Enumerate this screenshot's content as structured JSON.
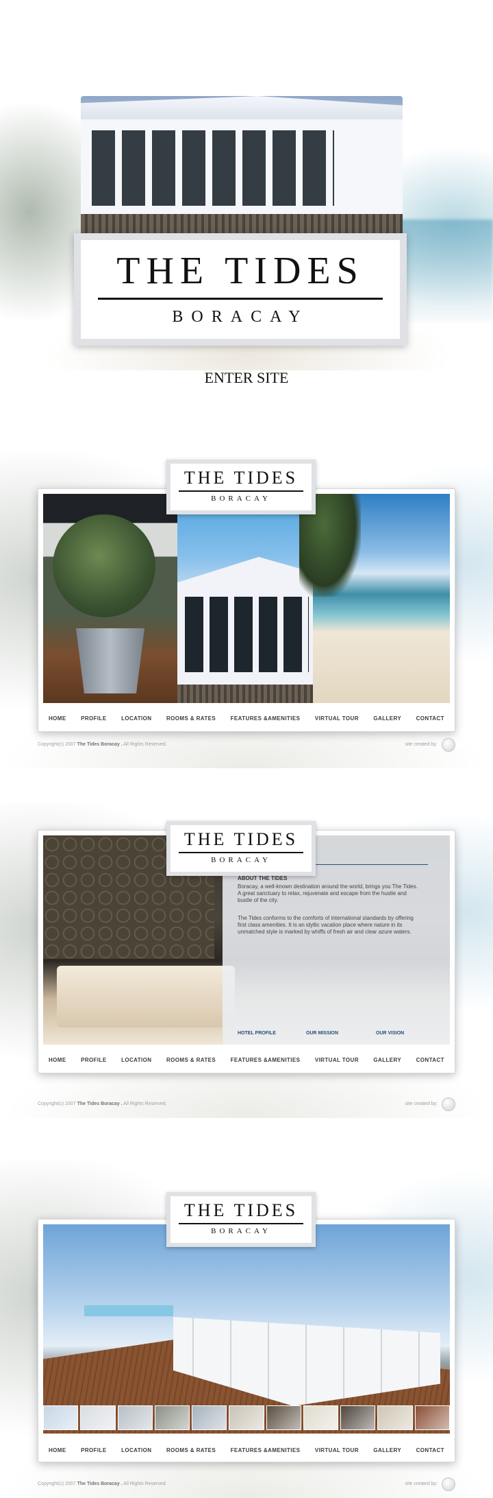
{
  "splash": {
    "brand_title": "THE TIDES",
    "brand_subtitle": "BORACAY",
    "enter_label": "ENTER SITE"
  },
  "brand": {
    "title": "THE TIDES",
    "subtitle": "BORACAY"
  },
  "nav": {
    "items": [
      "HOME",
      "PROFILE",
      "LOCATION",
      "ROOMS & RATES",
      "FEATURES &AMENITIES",
      "VIRTUAL TOUR",
      "GALLERY",
      "CONTACT"
    ]
  },
  "footer": {
    "copyright_prefix": "Copyright(c) 2007",
    "copyright_brand": "The Tides Boracay .",
    "copyright_suffix": "All Rights Reserved.",
    "credit": "site created by:"
  },
  "profile": {
    "title": "profile",
    "heading": "ABOUT THE TIDES",
    "paragraph1": "Boracay, a well-known destination around the world, brings you The Tides. A great sanctuary to relax, rejuvenate and escape from the hustle and bustle of the city.",
    "paragraph2": "The Tides conforms to the comforts of international standards by offering first class amenities. It is an idyllic vacation place where nature in its unmatched style is marked by whiffs of fresh air and clear azure waters.",
    "links": [
      "HOTEL PROFILE",
      "OUR  MISSION",
      "OUR VISION"
    ]
  },
  "gallery": {
    "thumbnail_colors": [
      "#c7d6e6",
      "#d9dde2",
      "#b7bfc7",
      "#8c8f86",
      "#a7b2bd",
      "#c9c3b5",
      "#5a4e40",
      "#e0dbcf",
      "#4f463d",
      "#cfc6b4",
      "#8a4f35"
    ]
  },
  "colors": {
    "accent": "#2a4c7a",
    "frame_border": "#dfe1e4"
  }
}
